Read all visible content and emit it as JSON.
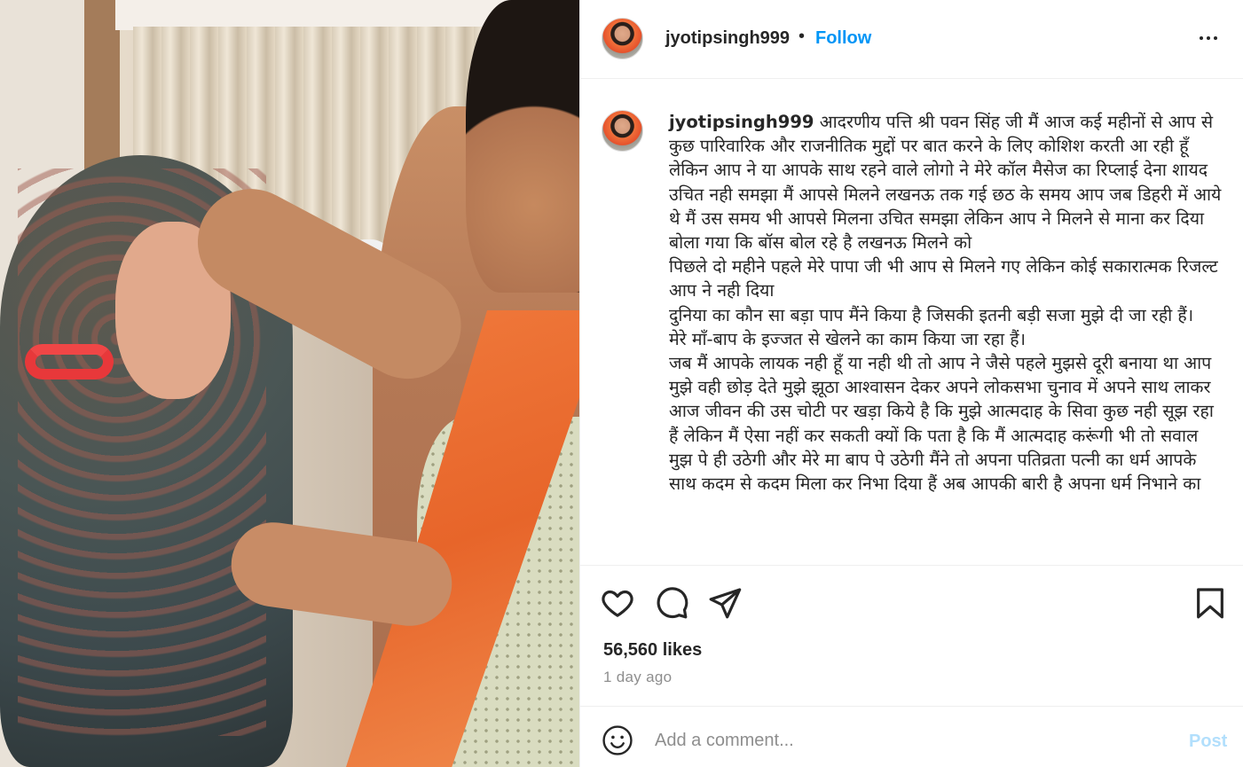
{
  "post": {
    "username": "jyotipsingh999",
    "separator": "•",
    "follow_label": "Follow",
    "caption_username": "jyotipsingh999",
    "caption_paragraphs": [
      "आदरणीय पत्ति श्री पवन सिंह जी मैं आज कई महीनों से आप से कुछ पारिवारिक और राजनीतिक मुद्दों पर बात करने के लिए कोशिश करती आ रही हूँ लेकिन आप ने या आपके साथ रहने वाले लोगो ने मेरे कॉल मैसेज का रिप्लाई देना शायद उचित नही समझा मैं आपसे मिलने लखनऊ तक गई छठ के समय आप जब डिहरी में आये थे मैं उस समय भी आपसे मिलना उचित समझा लेकिन आप ने मिलने से माना कर दिया बोला गया कि बॉस बोल रहे है लखनऊ मिलने को",
      "पिछले दो महीने पहले मेरे पापा जी भी आप से मिलने गए लेकिन कोई सकारात्मक रिजल्ट आप ने नही दिया",
      "दुनिया का कौन सा बड़ा पाप मैंने किया है जिसकी इतनी बड़ी सजा मुझे दी जा रही हैं।",
      "मेरे माँ-बाप के इज्जत से खेलने का काम किया जा रहा हैं।",
      "जब मैं आपके लायक नही हूँ या नही थी तो आप ने जैसे पहले मुझसे दूरी बनाया था आप मुझे वही छोड़ देते मुझे झूठा आश्वासन देकर अपने लोकसभा चुनाव में अपने साथ लाकर आज जीवन की उस चोटी पर खड़ा किये है कि मुझे आत्मदाह के सिवा कुछ नही सूझ रहा हैं लेकिन मैं ऐसा नहीं कर सकती क्यों कि पता है कि मैं आत्मदाह करूंगी भी तो सवाल मुझ पे ही उठेगी और मेरे मा बाप पे उठेगी मैंने तो अपना पतिव्रता पत्नी का धर्म आपके साथ कदम से कदम मिला कर निभा दिया हैं अब आपकी बारी है अपना धर्म निभाने का"
    ],
    "likes_text": "56,560 likes",
    "time_text": "1 day ago"
  },
  "comment": {
    "placeholder": "Add a comment...",
    "post_label": "Post"
  },
  "icons": {
    "like": "heart-icon",
    "comment": "speech-bubble-icon",
    "share": "paper-plane-icon",
    "save": "bookmark-icon",
    "more": "more-dots-icon",
    "emoji": "smiley-icon"
  },
  "colors": {
    "follow": "#0095f6",
    "post_disabled": "#b2dffc",
    "secondary_text": "#8e8e8e",
    "divider": "#efefef"
  }
}
